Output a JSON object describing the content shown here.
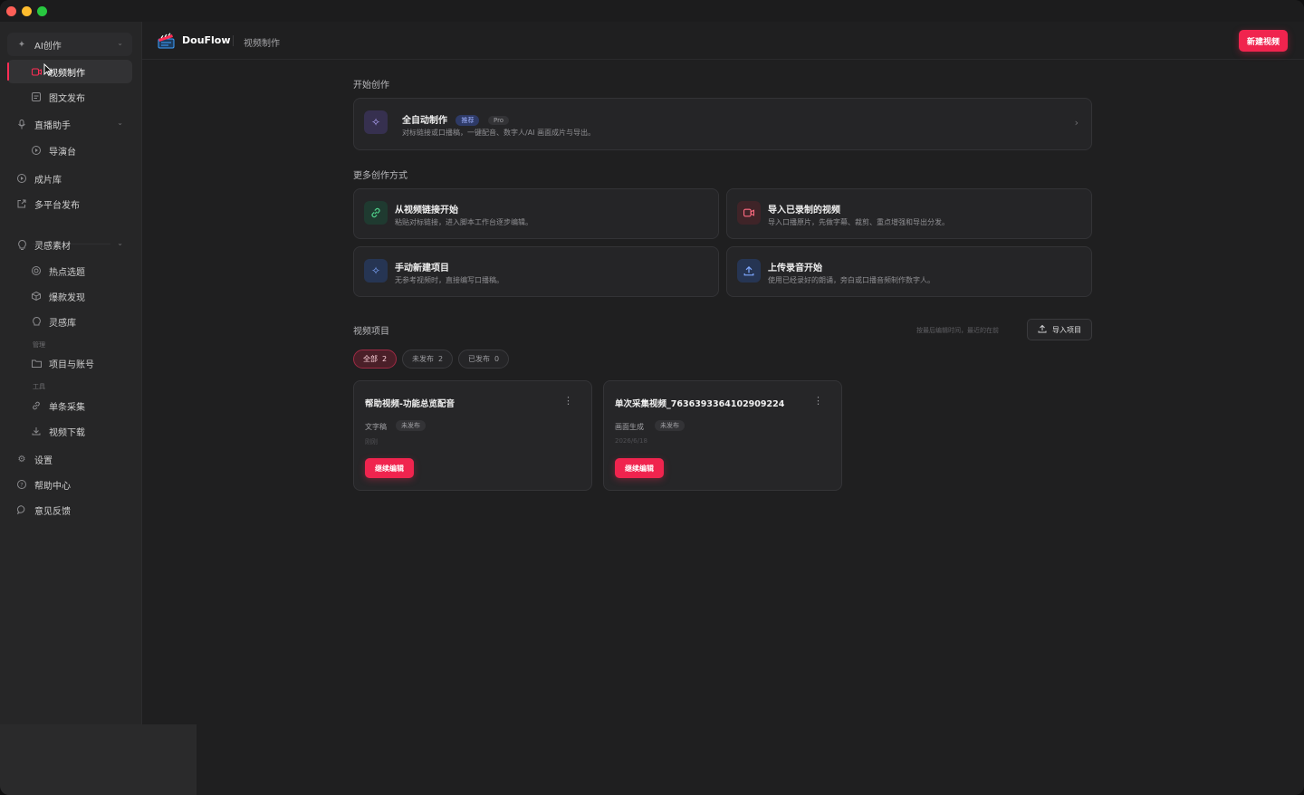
{
  "app": {
    "name": "DouFlow",
    "breadcrumb": "视频制作",
    "new_video_label": "新建视频"
  },
  "sidebar": {
    "groups": [
      {
        "label": "AI创作",
        "icon": "sparkle-icon",
        "expanded": true,
        "items": [
          {
            "label": "视频制作",
            "icon": "video-camera-icon",
            "active": true
          },
          {
            "label": "图文发布",
            "icon": "image-text-icon"
          }
        ]
      },
      {
        "label": "直播助手",
        "icon": "microphone-icon",
        "expanded": true,
        "items": [
          {
            "label": "导演台",
            "icon": "play-circle-icon"
          }
        ]
      }
    ],
    "top_items": [
      {
        "label": "成片库",
        "icon": "play-circle-icon"
      },
      {
        "label": "多平台发布",
        "icon": "share-icon"
      }
    ],
    "inspiration": {
      "label": "灵感素材",
      "icon": "lightbulb-icon",
      "items": [
        {
          "label": "热点选题",
          "icon": "target-icon"
        },
        {
          "label": "爆款发现",
          "icon": "cube-icon"
        },
        {
          "label": "灵感库",
          "icon": "lightbulb-icon"
        }
      ]
    },
    "manage_caption": "管理",
    "manage_items": [
      {
        "label": "项目与账号",
        "icon": "folder-icon"
      }
    ],
    "tools_caption": "工具",
    "tools_items": [
      {
        "label": "单条采集",
        "icon": "link-icon"
      },
      {
        "label": "视频下载",
        "icon": "download-icon"
      }
    ],
    "bottom_items": [
      {
        "label": "设置",
        "icon": "gear-icon"
      },
      {
        "label": "帮助中心",
        "icon": "help-icon"
      },
      {
        "label": "意见反馈",
        "icon": "chat-bubble-icon"
      }
    ]
  },
  "main": {
    "start_title": "开始创作",
    "auto_card": {
      "title": "全自动制作",
      "badge_rec": "推荐",
      "badge_pro": "Pro",
      "desc": "对标链接或口播稿，一键配音、数字人/AI 画面成片与导出。"
    },
    "more_title": "更多创作方式",
    "methods": [
      {
        "title": "从视频链接开始",
        "desc": "粘贴对标链接，进入脚本工作台逐步编辑。",
        "icon": "link-icon"
      },
      {
        "title": "导入已录制的视频",
        "desc": "导入口播原片，先做字幕、裁剪、重点增强和导出分发。",
        "icon": "video-camera-icon"
      },
      {
        "title": "手动新建项目",
        "desc": "无参考视频时，直接编写口播稿。",
        "icon": "sparkle-icon"
      },
      {
        "title": "上传录音开始",
        "desc": "使用已经录好的朗诵，旁白或口播音频制作数字人。",
        "icon": "upload-icon"
      }
    ],
    "projects_title": "视频项目",
    "sort_hint": "按最后编辑时间，最近的在前",
    "import_label": "导入项目",
    "filters": [
      {
        "label": "全部",
        "count": "2",
        "active": true
      },
      {
        "label": "未发布",
        "count": "2"
      },
      {
        "label": "已发布",
        "count": "0"
      }
    ],
    "projects": [
      {
        "title": "帮助视频-功能总览配音",
        "type": "文字稿",
        "status": "未发布",
        "date": "刚刚",
        "edit_label": "继续编辑"
      },
      {
        "title": "单次采集视频_7636393364102909224",
        "type": "画面生成",
        "status": "未发布",
        "date": "2026/6/18",
        "edit_label": "继续编辑"
      }
    ]
  },
  "colors": {
    "accent": "#f0244e",
    "bg": "#1f1f20",
    "sidebar": "#262627"
  }
}
